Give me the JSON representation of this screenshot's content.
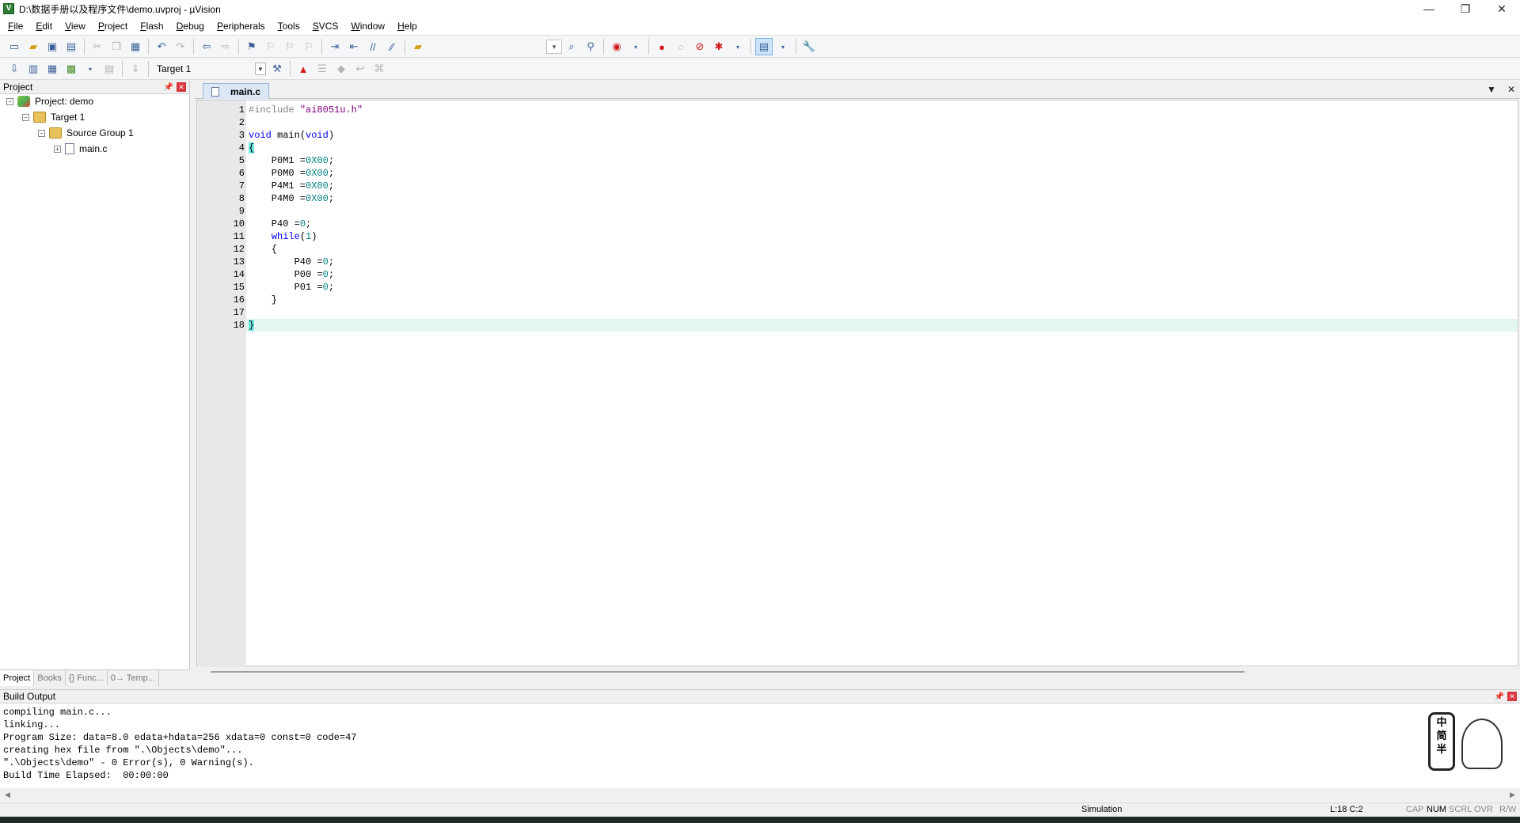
{
  "window": {
    "title": "D:\\数据手册以及程序文件\\demo.uvproj - µVision",
    "minimize": "—",
    "maximize": "❐",
    "close": "✕"
  },
  "menu": {
    "items": [
      {
        "acc": "F",
        "rest": "ile"
      },
      {
        "acc": "E",
        "rest": "dit"
      },
      {
        "acc": "V",
        "rest": "iew"
      },
      {
        "acc": "P",
        "rest": "roject"
      },
      {
        "acc": "F",
        "rest": "lash"
      },
      {
        "acc": "D",
        "rest": "ebug"
      },
      {
        "acc": "P",
        "rest": "eripherals"
      },
      {
        "acc": "T",
        "rest": "ools"
      },
      {
        "acc": "S",
        "rest": "VCS"
      },
      {
        "acc": "W",
        "rest": "indow"
      },
      {
        "acc": "H",
        "rest": "elp"
      }
    ]
  },
  "toolbar2": {
    "target": "Target 1"
  },
  "project_panel": {
    "title": "Project",
    "tree": {
      "project": "Project: demo",
      "target": "Target 1",
      "group": "Source Group 1",
      "file": "main.c"
    },
    "tabs": [
      "Project",
      "Books",
      "{} Func...",
      "0→ Temp..."
    ]
  },
  "editor": {
    "tab": "main.c",
    "current_line": 18,
    "lines": [
      "#include \"ai8051u.h\"",
      "",
      "void main(void)",
      "{",
      "    P0M1 =0X00;",
      "    P0M0 =0X00;",
      "    P4M1 =0X00;",
      "    P4M0 =0X00;",
      "",
      "    P40 =0;",
      "    while(1)",
      "    {",
      "        P40 =0;",
      "        P00 =0;",
      "        P01 =0;",
      "    }",
      "",
      "}"
    ]
  },
  "build_output": {
    "title": "Build Output",
    "lines": [
      "compiling main.c...",
      "linking...",
      "Program Size: data=8.0 edata+hdata=256 xdata=0 const=0 code=47",
      "creating hex file from \".\\Objects\\demo\"...",
      "\".\\Objects\\demo\" - 0 Error(s), 0 Warning(s).",
      "Build Time Elapsed:  00:00:00"
    ],
    "mascot_text": [
      "中",
      "简",
      "半"
    ]
  },
  "status": {
    "mode": "Simulation",
    "position": "L:18 C:2",
    "cap": "CAP",
    "num": "NUM",
    "scrl": "SCRL",
    "ovr": "OVR",
    "rw": "R/W"
  }
}
